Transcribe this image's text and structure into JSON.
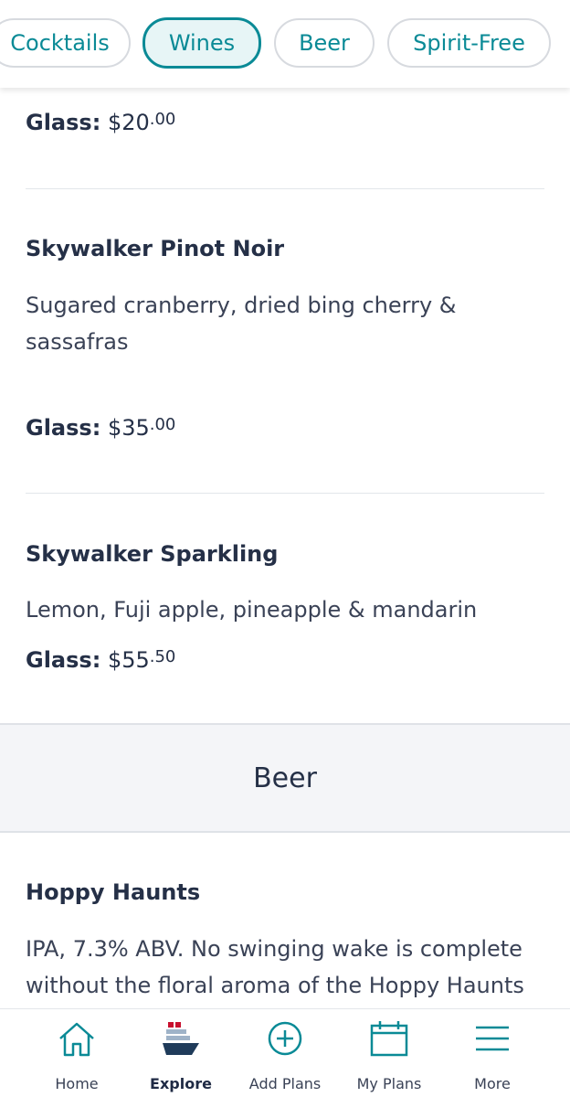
{
  "tabs": {
    "cocktails": "Cocktails",
    "wines": "Wines",
    "beer": "Beer",
    "spirit_free": "Spirit-Free"
  },
  "wines": {
    "top_price": {
      "label": "Glass:",
      "dollars": "$20",
      "cents": ".00"
    },
    "items": [
      {
        "name": "Skywalker Pinot Noir",
        "description": "Sugared cranberry, dried bing cherry & sassafras",
        "price_label": "Glass:",
        "price_dollars": "$35",
        "price_cents": ".00"
      },
      {
        "name": "Skywalker Sparkling",
        "description": "Lemon, Fuji apple, pineapple & mandarin",
        "price_label": "Glass:",
        "price_dollars": "$55",
        "price_cents": ".50"
      }
    ]
  },
  "beer_section": {
    "title": "Beer",
    "items": [
      {
        "name": "Hoppy Haunts",
        "description": "IPA, 7.3% ABV. No swinging wake is complete without the floral aroma of the Hoppy Haunts"
      }
    ]
  },
  "bottom_nav": {
    "home": "Home",
    "explore": "Explore",
    "add_plans": "Add Plans",
    "my_plans": "My Plans",
    "more": "More"
  },
  "colors": {
    "accent": "#0a8a96",
    "text": "#253047",
    "ship_red": "#c8102e",
    "ship_navy": "#1f3b5a"
  }
}
